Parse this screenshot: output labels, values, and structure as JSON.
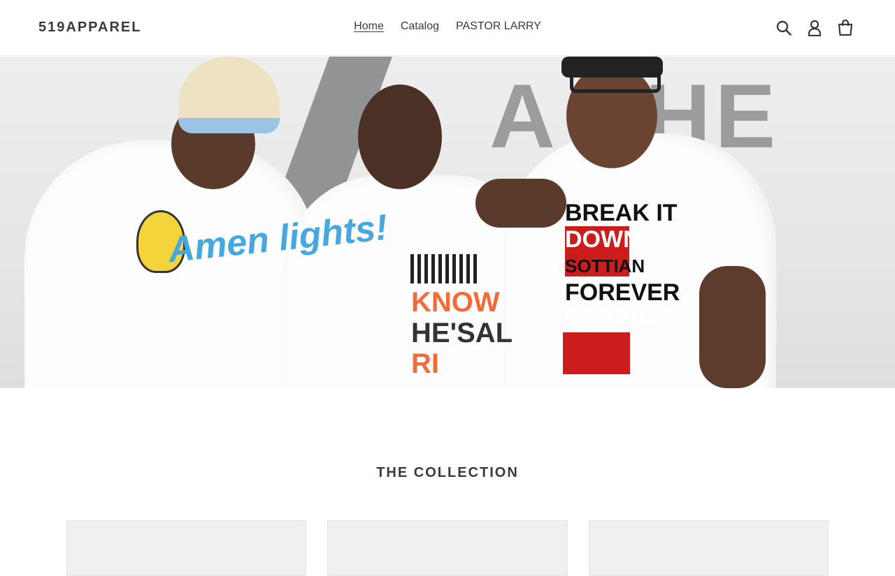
{
  "header": {
    "logo": "519APPAREL",
    "nav": [
      {
        "label": "Home",
        "active": true
      },
      {
        "label": "Catalog",
        "active": false
      },
      {
        "label": "PASTOR LARRY",
        "active": false
      }
    ],
    "icons": [
      "search-icon",
      "account-icon",
      "cart-icon"
    ]
  },
  "hero": {
    "wall_text": "A THE",
    "prints": {
      "amen": "Amen lights!",
      "know_line1": "KNOW",
      "know_line2": "HE'SAL",
      "know_line3": "RI",
      "break_line1": "BREAK IT",
      "break_line2": "DOWN",
      "break_line3": "SOTTIAN",
      "break_line4": "FOREVER",
      "break_line5": "BE BROKE"
    }
  },
  "collection": {
    "title": "THE COLLECTION",
    "cards": [
      {},
      {},
      {}
    ]
  },
  "colors": {
    "text": "#3a3a3a",
    "card_bg": "#eff0f2",
    "print_red": "#cc1d1d",
    "print_orange": "#f26b3a",
    "print_blue": "#46a8df"
  }
}
